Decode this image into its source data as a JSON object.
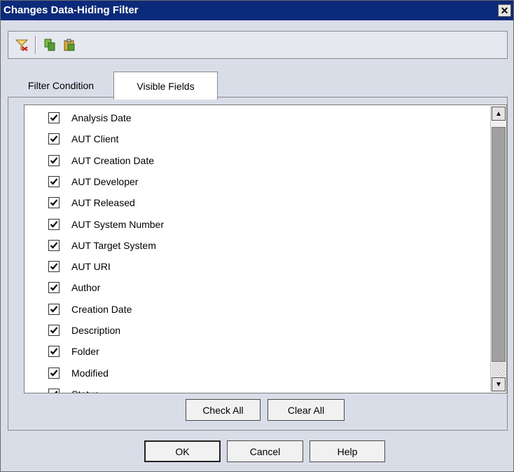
{
  "window": {
    "title": "Changes Data-Hiding Filter",
    "close_glyph": "✕"
  },
  "toolbar": {
    "icons": [
      "filter-icon",
      "copy-icon",
      "paste-icon"
    ]
  },
  "tabs": [
    {
      "label": "Filter Condition",
      "active": false
    },
    {
      "label": "Visible Fields",
      "active": true
    }
  ],
  "fields": [
    {
      "label": "Analysis Date",
      "checked": true
    },
    {
      "label": "AUT Client",
      "checked": true
    },
    {
      "label": "AUT Creation Date",
      "checked": true
    },
    {
      "label": "AUT Developer",
      "checked": true
    },
    {
      "label": "AUT Released",
      "checked": true
    },
    {
      "label": "AUT System Number",
      "checked": true
    },
    {
      "label": "AUT Target System",
      "checked": true
    },
    {
      "label": "AUT URI",
      "checked": true
    },
    {
      "label": "Author",
      "checked": true
    },
    {
      "label": "Creation Date",
      "checked": true
    },
    {
      "label": "Description",
      "checked": true
    },
    {
      "label": "Folder",
      "checked": true
    },
    {
      "label": "Modified",
      "checked": true
    },
    {
      "label": "Status",
      "checked": true
    }
  ],
  "panel_buttons": {
    "check_all": "Check All",
    "clear_all": "Clear All"
  },
  "footer_buttons": {
    "ok": "OK",
    "cancel": "Cancel",
    "help": "Help"
  },
  "colors": {
    "titlebar": "#0c2a7a",
    "dialog_bg": "#d9dde8",
    "check": "#000000"
  }
}
